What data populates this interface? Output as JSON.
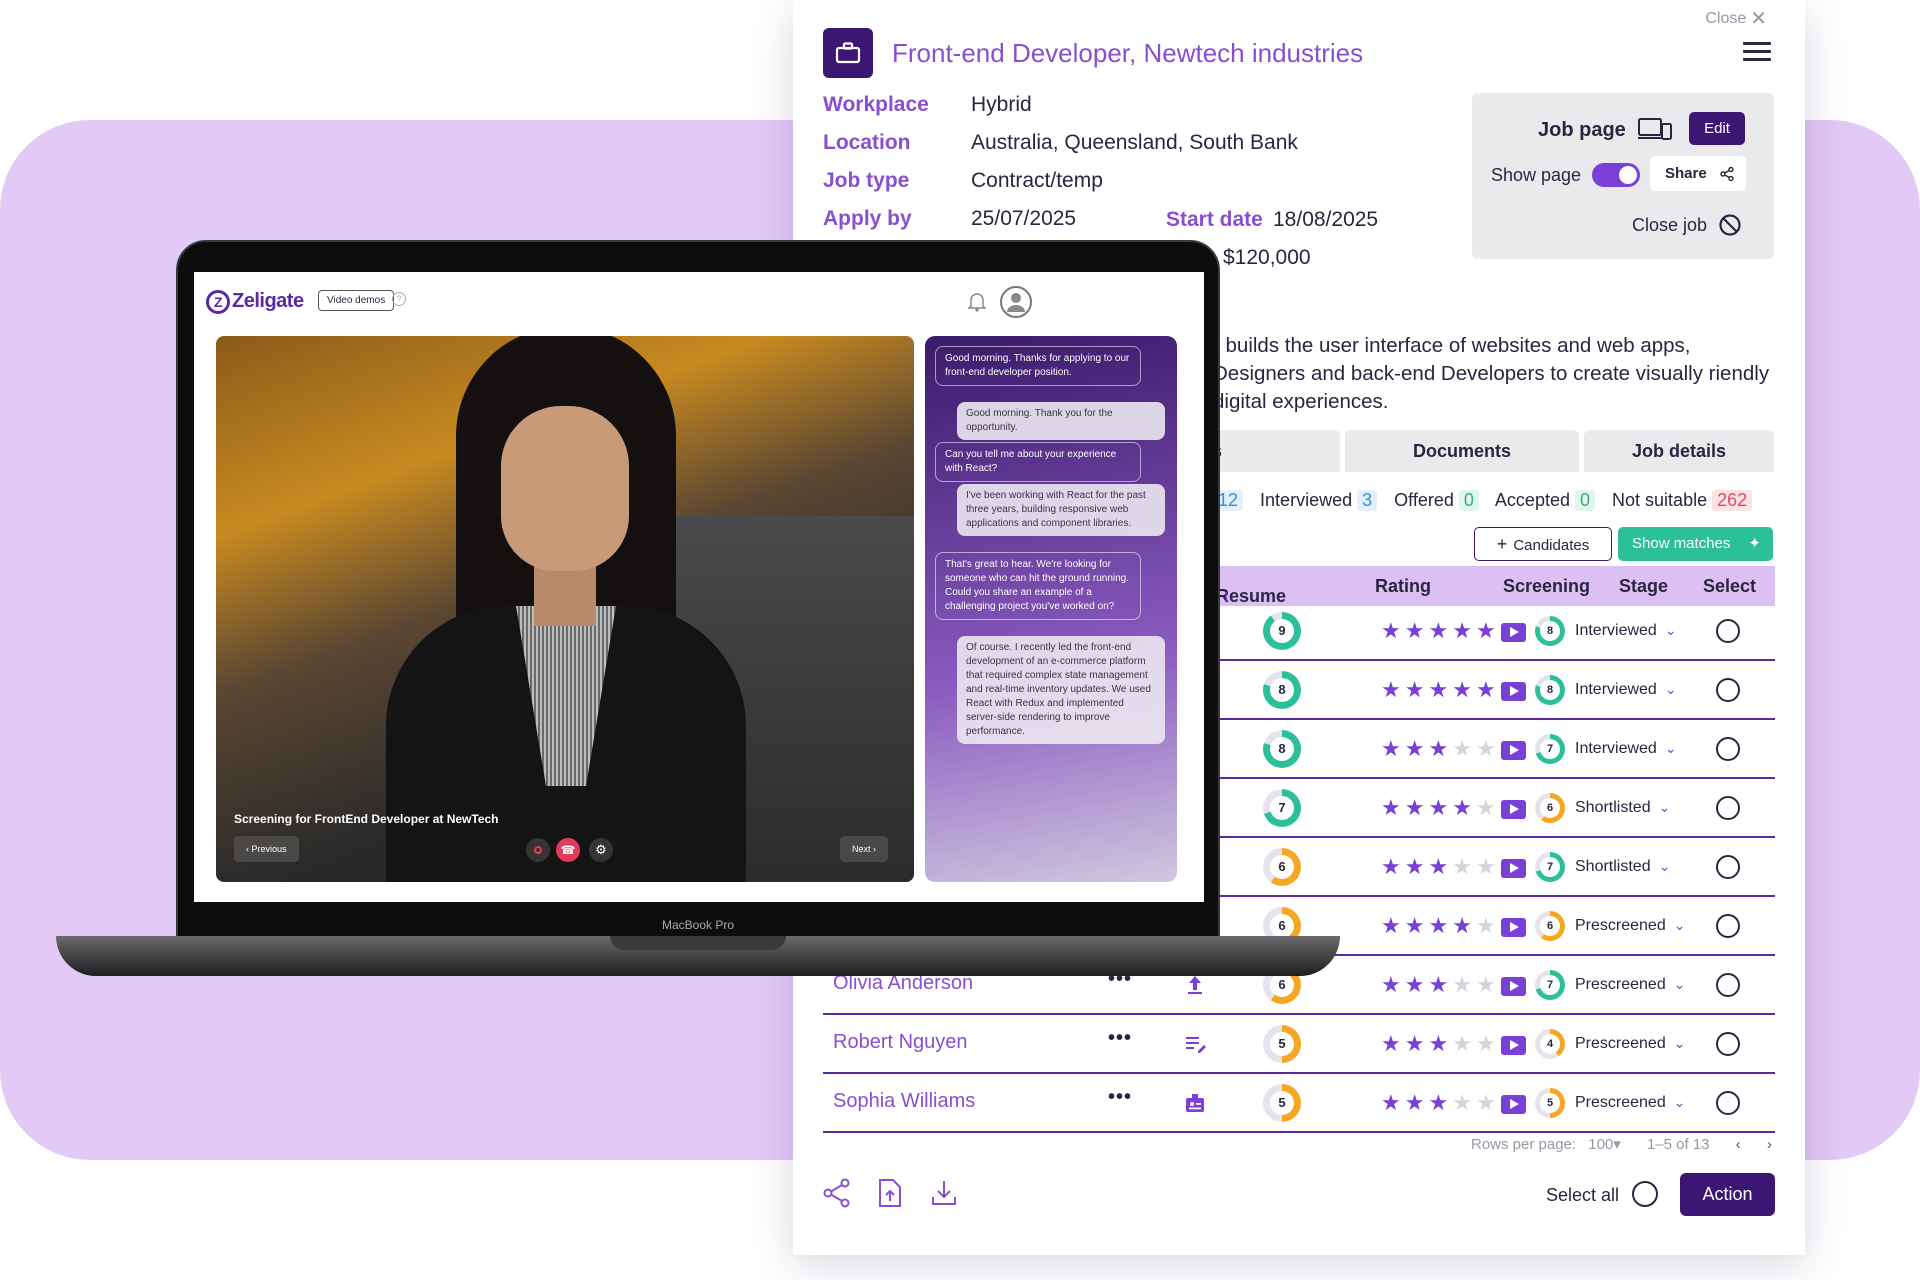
{
  "panel": {
    "close_label": "Close",
    "job_title": "Front-end Developer, Newtech industries",
    "fields": [
      {
        "key": "Workplace",
        "value": "Hybrid"
      },
      {
        "key": "Location",
        "value": "Australia, Queensland, South Bank"
      },
      {
        "key": "Job type",
        "value": "Contract/temp"
      },
      {
        "key": "Apply by",
        "value": "25/07/2025"
      }
    ],
    "start_date_label": "Start date",
    "start_date_value": "18/08/2025",
    "salary": "$120,000",
    "description": "r builds the user interface of websites and web apps, Designers and back-end Developers to create visually riendly digital experiences.",
    "job_page": {
      "label": "Job page",
      "edit": "Edit",
      "show_page": "Show page",
      "share": "Share",
      "close_job": "Close job"
    },
    "tabs": [
      "s",
      "Documents",
      "Job details"
    ],
    "stats": [
      {
        "label": "",
        "count": "12",
        "color": "blue"
      },
      {
        "label": "Interviewed",
        "count": "3",
        "color": "blue"
      },
      {
        "label": "Offered",
        "count": "0",
        "color": "green"
      },
      {
        "label": "Accepted",
        "count": "0",
        "color": "green"
      },
      {
        "label": "Not suitable",
        "count": "262",
        "color": "red"
      }
    ],
    "candidates_button": "Candidates",
    "show_matches_button": "Show matches",
    "columns": [
      "e",
      "Resume",
      "Rating",
      "Screening",
      "Stage",
      "Select"
    ],
    "rows": [
      {
        "name": "",
        "resume": 9,
        "rating": 5,
        "screening": 8,
        "stage": "Interviewed"
      },
      {
        "name": "",
        "resume": 8,
        "rating": 5,
        "screening": 8,
        "stage": "Interviewed"
      },
      {
        "name": "",
        "resume": 8,
        "rating": 3,
        "screening": 7,
        "stage": "Interviewed"
      },
      {
        "name": "",
        "resume": 7,
        "rating": 4,
        "screening": 6,
        "stage": "Shortlisted"
      },
      {
        "name": "",
        "resume": 6,
        "rating": 3,
        "screening": 7,
        "stage": "Shortlisted"
      },
      {
        "name": "",
        "resume": 6,
        "rating": 4,
        "screening": 6,
        "stage": "Prescreened"
      },
      {
        "name": "Olivia Anderson",
        "resume": 6,
        "rating": 3,
        "screening": 7,
        "stage": "Prescreened"
      },
      {
        "name": "Robert Nguyen",
        "resume": 5,
        "rating": 3,
        "screening": 4,
        "stage": "Prescreened"
      },
      {
        "name": "Sophia Williams",
        "resume": 5,
        "rating": 3,
        "screening": 5,
        "stage": "Prescreened"
      }
    ],
    "pager": {
      "rows_label": "Rows per page:",
      "rows_value": "100",
      "range": "1–5 of 13"
    },
    "select_all": "Select all",
    "action": "Action"
  },
  "laptop": {
    "brand": "Zeligate",
    "video_demos": "Video demos",
    "caption": "Screening for FrontEnd Developer at NewTech",
    "previous": "Previous",
    "next": "Next",
    "model": "MacBook Pro",
    "chat": [
      {
        "from": "q",
        "text": "Good morning. Thanks for applying to our front-end developer position."
      },
      {
        "from": "a",
        "text": "Good morning. Thank you for the opportunity."
      },
      {
        "from": "q",
        "text": "Can you tell me about your experience with React?"
      },
      {
        "from": "a",
        "text": "I've been working with React for the past three years, building responsive web applications and component libraries."
      },
      {
        "from": "q",
        "text": "That's great to hear. We're looking for someone who can hit the ground running. Could you share an example of a challenging project you've worked on?"
      },
      {
        "from": "a",
        "text": "Of course. I recently led the front-end development of an e-commerce platform that required complex state management and real-time inventory updates. We used React with Redux and implemented server-side rendering to improve performance."
      }
    ]
  },
  "colors": {
    "accent": "#8a4fd0",
    "dark": "#3b1673",
    "teal": "#2bbf9a",
    "bg": "#e2c9f6"
  }
}
